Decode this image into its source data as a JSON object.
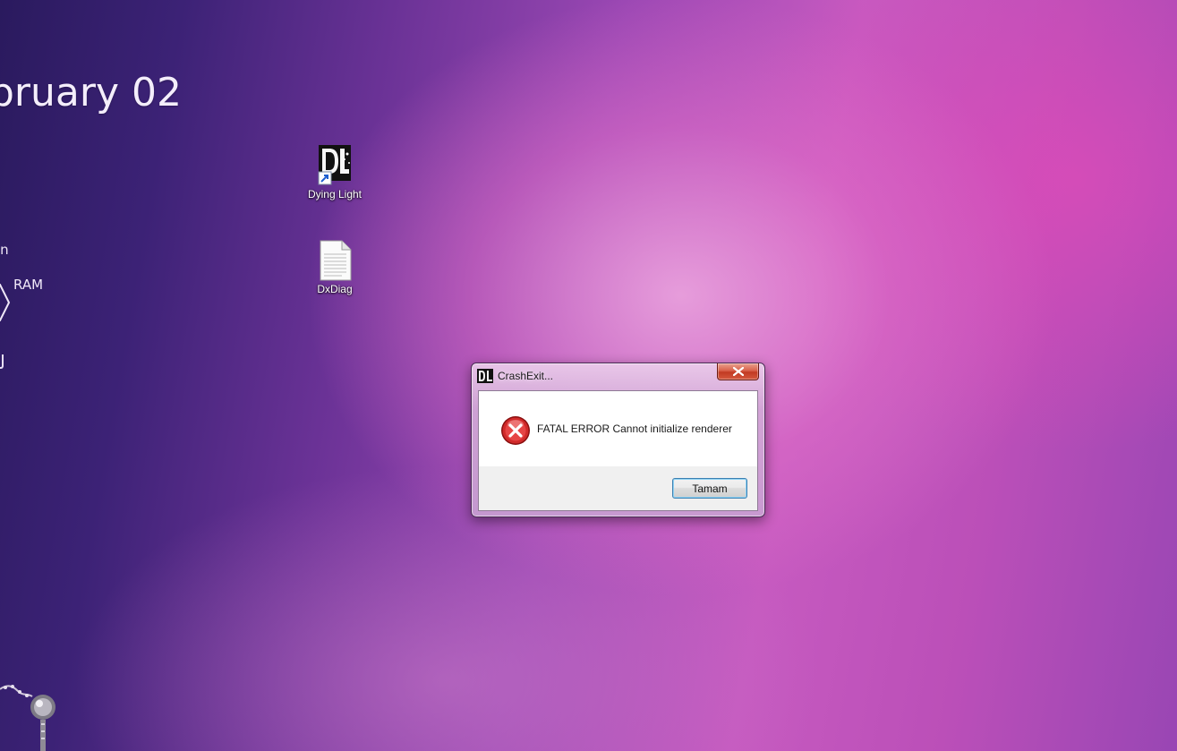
{
  "desktop": {
    "gadgets": {
      "date_text": "bruary 02",
      "partial_text": "in",
      "ram_label": "RAM"
    },
    "icons": [
      {
        "label": "Dying Light",
        "icon": "dying-light-shortcut-icon"
      },
      {
        "label": "DxDiag",
        "icon": "text-document-icon"
      }
    ]
  },
  "dialog": {
    "title": "CrashExit...",
    "title_icon": "dying-light-app-icon",
    "close_icon": "close-icon",
    "message": "FATAL ERROR Cannot initialize renderer",
    "message_icon": "error-icon",
    "ok_label": "Tamam"
  },
  "colors": {
    "error_red": "#d12a2a",
    "close_button_red": "#c23a22",
    "focus_blue": "#3c7fb1"
  }
}
